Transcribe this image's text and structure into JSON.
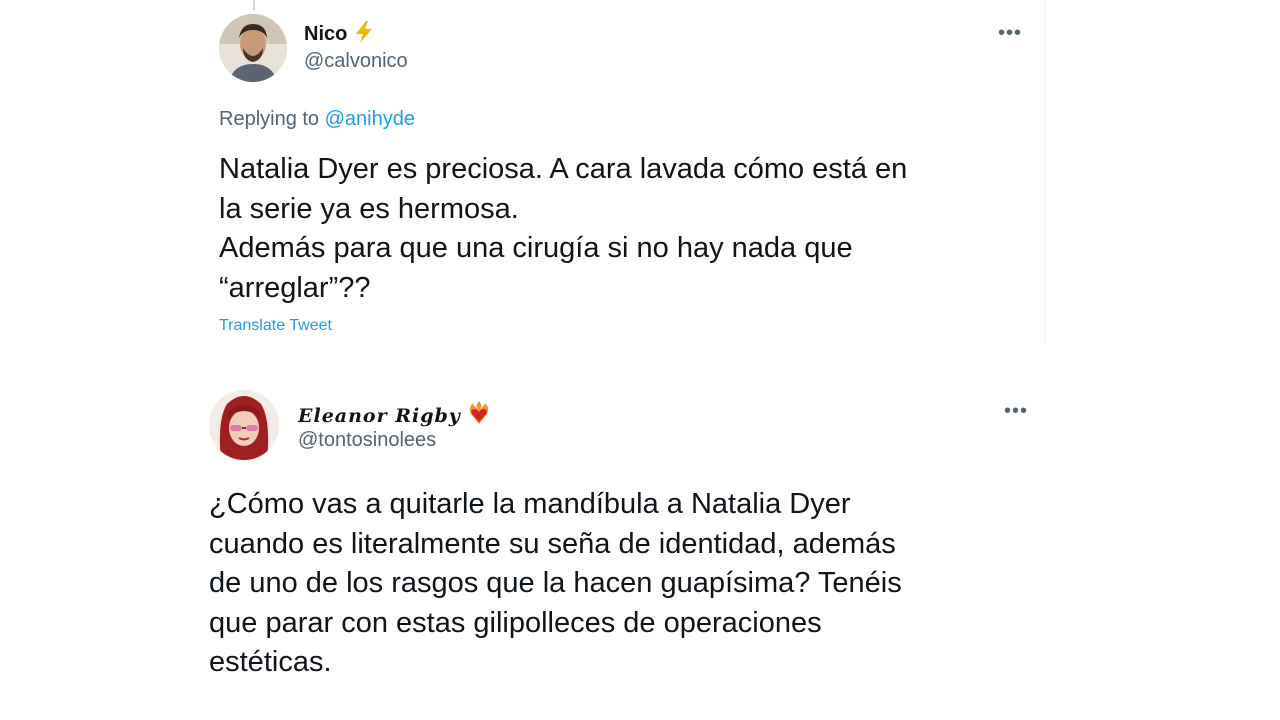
{
  "tweet1": {
    "display_name": "Nico",
    "handle": "@calvonico",
    "replying_prefix": "Replying to",
    "replying_handle": "@anihyde",
    "text": "Natalia Dyer es preciosa. A cara lavada cómo está en\nla serie ya es hermosa.\nAdemás para que una cirugía si no hay nada que\n“arreglar”??",
    "translate_label": "Translate Tweet",
    "more_label": "•••",
    "badge_icon": "lightning-bolt-icon"
  },
  "tweet2": {
    "display_name": "Eleanor Rigby",
    "handle": "@tontosinolees",
    "text": "¿Cómo vas a quitarle la mandíbula a Natalia Dyer\ncuando es literalmente su seña de identidad, además\nde uno de los rasgos que la hacen guapísima? Tenéis\nque parar con estas gilipolleces de operaciones\nestéticas.",
    "more_label": "•••",
    "badge_icon": "flaming-heart-icon"
  },
  "colors": {
    "link": "#1d9bf0",
    "secondary_text": "#536471",
    "primary_text": "#0f1419",
    "bolt": "#f4b400"
  }
}
